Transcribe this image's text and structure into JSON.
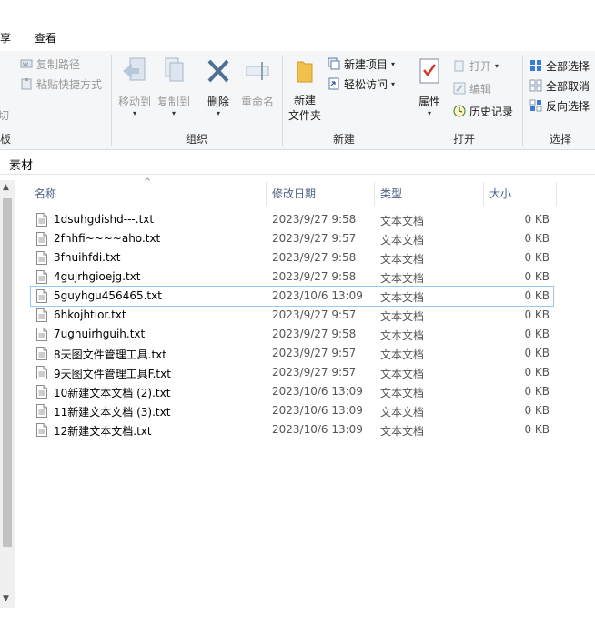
{
  "tabs": {
    "share": "享",
    "view": "查看"
  },
  "ribbon": {
    "clipboard": {
      "copy_path": "复制路径",
      "paste_shortcut": "粘贴快捷方式",
      "cut": "剪切",
      "label": "板"
    },
    "organize": {
      "move_to": "移动到",
      "copy_to": "复制到",
      "delete": "删除",
      "rename": "重命名",
      "label": "组织"
    },
    "new": {
      "new_folder_line1": "新建",
      "new_folder_line2": "文件夹",
      "new_item": "新建项目",
      "easy_access": "轻松访问",
      "label": "新建"
    },
    "open": {
      "properties": "属性",
      "open": "打开",
      "edit": "编辑",
      "history": "历史记录",
      "label": "打开"
    },
    "select": {
      "select_all": "全部选择",
      "select_none": "全部取消",
      "invert": "反向选择",
      "label": "选择"
    }
  },
  "address": {
    "folder": "素材"
  },
  "columns": {
    "name": "名称",
    "date": "修改日期",
    "type": "类型",
    "size": "大小"
  },
  "files": [
    {
      "name": "1dsuhgdishd---.txt",
      "date": "2023/9/27 9:58",
      "type": "文本文档",
      "size": "0 KB"
    },
    {
      "name": "2fhhfi~~~~aho.txt",
      "date": "2023/9/27 9:57",
      "type": "文本文档",
      "size": "0 KB"
    },
    {
      "name": "3fhuihfdi.txt",
      "date": "2023/9/27 9:58",
      "type": "文本文档",
      "size": "0 KB"
    },
    {
      "name": "4gujrhgioejg.txt",
      "date": "2023/9/27 9:58",
      "type": "文本文档",
      "size": "0 KB"
    },
    {
      "name": "5guyhgu456465.txt",
      "date": "2023/10/6 13:09",
      "type": "文本文档",
      "size": "0 KB"
    },
    {
      "name": "6hkojhtior.txt",
      "date": "2023/9/27 9:57",
      "type": "文本文档",
      "size": "0 KB"
    },
    {
      "name": "7ughuirhguih.txt",
      "date": "2023/9/27 9:58",
      "type": "文本文档",
      "size": "0 KB"
    },
    {
      "name": "8天图文件管理工具.txt",
      "date": "2023/9/27 9:57",
      "type": "文本文档",
      "size": "0 KB"
    },
    {
      "name": "9天图文件管理工具F.txt",
      "date": "2023/9/27 9:57",
      "type": "文本文档",
      "size": "0 KB"
    },
    {
      "name": "10新建文本文档 (2).txt",
      "date": "2023/10/6 13:09",
      "type": "文本文档",
      "size": "0 KB"
    },
    {
      "name": "11新建文本文档 (3).txt",
      "date": "2023/10/6 13:09",
      "type": "文本文档",
      "size": "0 KB"
    },
    {
      "name": "12新建文本文档.txt",
      "date": "2023/10/6 13:09",
      "type": "文本文档",
      "size": "0 KB"
    }
  ]
}
